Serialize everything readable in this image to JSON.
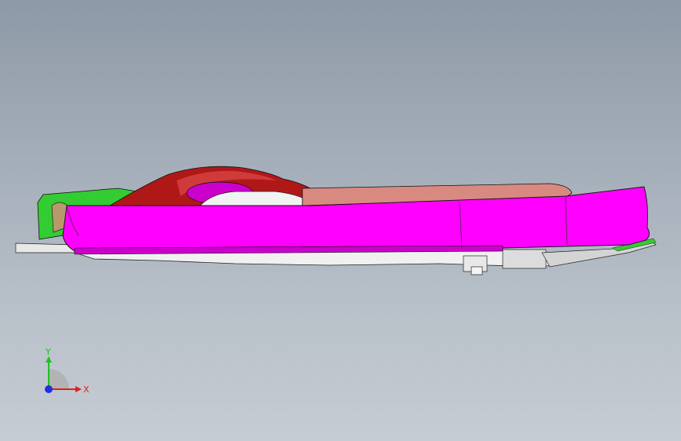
{
  "viewport": {
    "background_top": "#8d99a6",
    "background_bottom": "#c6ccd3",
    "view_name": "front-view-3d-model"
  },
  "model": {
    "colors": {
      "magenta_body": "#ff00ff",
      "magenta_shadow": "#cc00cc",
      "dark_red_top": "#b01818",
      "red_highlight": "#d03a3a",
      "salmon_cover": "#d98a80",
      "green_part": "#33cc33",
      "white_parts": "#f2f2f2",
      "tan_part": "#b89a6a",
      "edge": "#000000"
    }
  },
  "triad": {
    "x_label": "X",
    "y_label": "Y",
    "x_color": "#e02020",
    "y_color": "#20c020",
    "origin_color": "#2030e0"
  }
}
